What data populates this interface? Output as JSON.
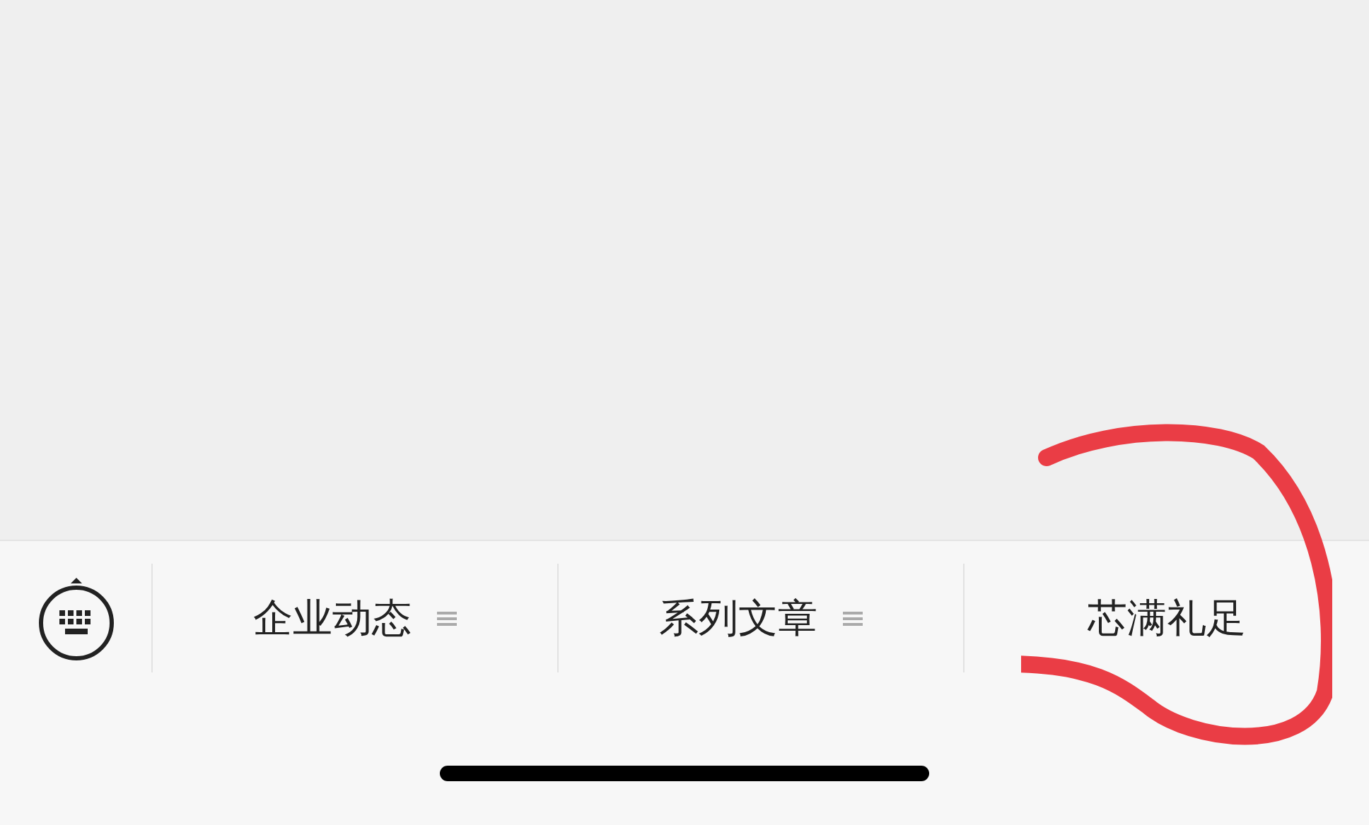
{
  "menu": {
    "items": [
      {
        "label": "企业动态",
        "has_submenu": true
      },
      {
        "label": "系列文章",
        "has_submenu": true
      },
      {
        "label": "芯满礼足",
        "has_submenu": false
      }
    ]
  }
}
